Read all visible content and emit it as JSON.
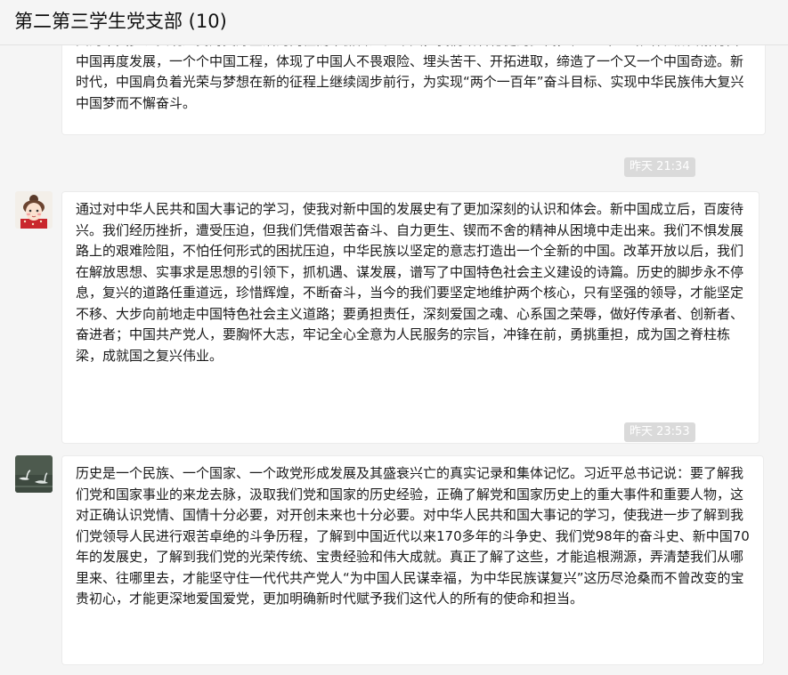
{
  "header": {
    "title": "第二第三学生党支部 (10)"
  },
  "messages": [
    {
      "text": "共的中国梦、实现人民对美好生活的向往而不懈奋进。今天，我们踏着稳健的步伐，在“一带一路”伟大战略指引下中国再度发展，一个个中国工程，体现了中国人不畏艰险、埋头苦干、开拓进取，缔造了一个又一个中国奇迹。新时代，中国肩负着光荣与梦想在新的征程上继续阔步前行，为实现“两个一百年”奋斗目标、实现中华民族伟大复兴中国梦而不懈奋斗。"
    },
    {
      "time": "昨天 21:34",
      "avatar": "girl-avatar",
      "text": "通过对中华人民共和国大事记的学习，使我对新中国的发展史有了更加深刻的认识和体会。新中国成立后，百废待兴。我们经历挫折，遭受压迫，但我们凭借艰苦奋斗、自力更生、锲而不舍的精神从困境中走出来。我们不惧发展路上的艰难险阻，不怕任何形式的困扰压迫，中华民族以坚定的意志打造出一个全新的中国。改革开放以后，我们在解放思想、实事求是思想的引领下，抓机遇、谋发展，谱写了中国特色社会主义建设的诗篇。历史的脚步永不停息，复兴的道路任重道远，珍惜辉煌，不断奋斗，当今的我们要坚定地维护两个核心，只有坚强的领导，才能坚定不移、大步向前地走中国特色社会主义道路；要勇担责任，深刻爱国之魂、心系国之荣辱，做好传承者、创新者、奋进者；中国共产党人，要胸怀大志，牢记全心全意为人民服务的宗旨，冲锋在前，勇挑重担，成为国之脊柱栋梁，成就国之复兴伟业。"
    },
    {
      "time": "昨天 23:53",
      "avatar": "swan-avatar",
      "text": "历史是一个民族、一个国家、一个政党形成发展及其盛衰兴亡的真实记录和集体记忆。习近平总书记说：要了解我们党和国家事业的来龙去脉，汲取我们党和国家的历史经验，正确了解党和国家历史上的重大事件和重要人物，这对正确认识党情、国情十分必要，对开创未来也十分必要。对中华人民共和国大事记的学习，使我进一步了解到我们党领导人民进行艰苦卓绝的斗争历程，了解到中国近代以来170多年的斗争史、我们党98年的奋斗史、新中国70年的发展史，了解到我们党的光荣传统、宝贵经验和伟大成就。真正了解了这些，才能追根溯源，弄清楚我们从哪里来、往哪里去，才能坚守住一代代共产党人“为中国人民谋幸福，为中华民族谋复兴”这历尽沧桑而不曾改变的宝贵初心，才能更深地爱国爱党，更加明确新时代赋予我们这代人的所有的使命和担当。"
    }
  ]
}
